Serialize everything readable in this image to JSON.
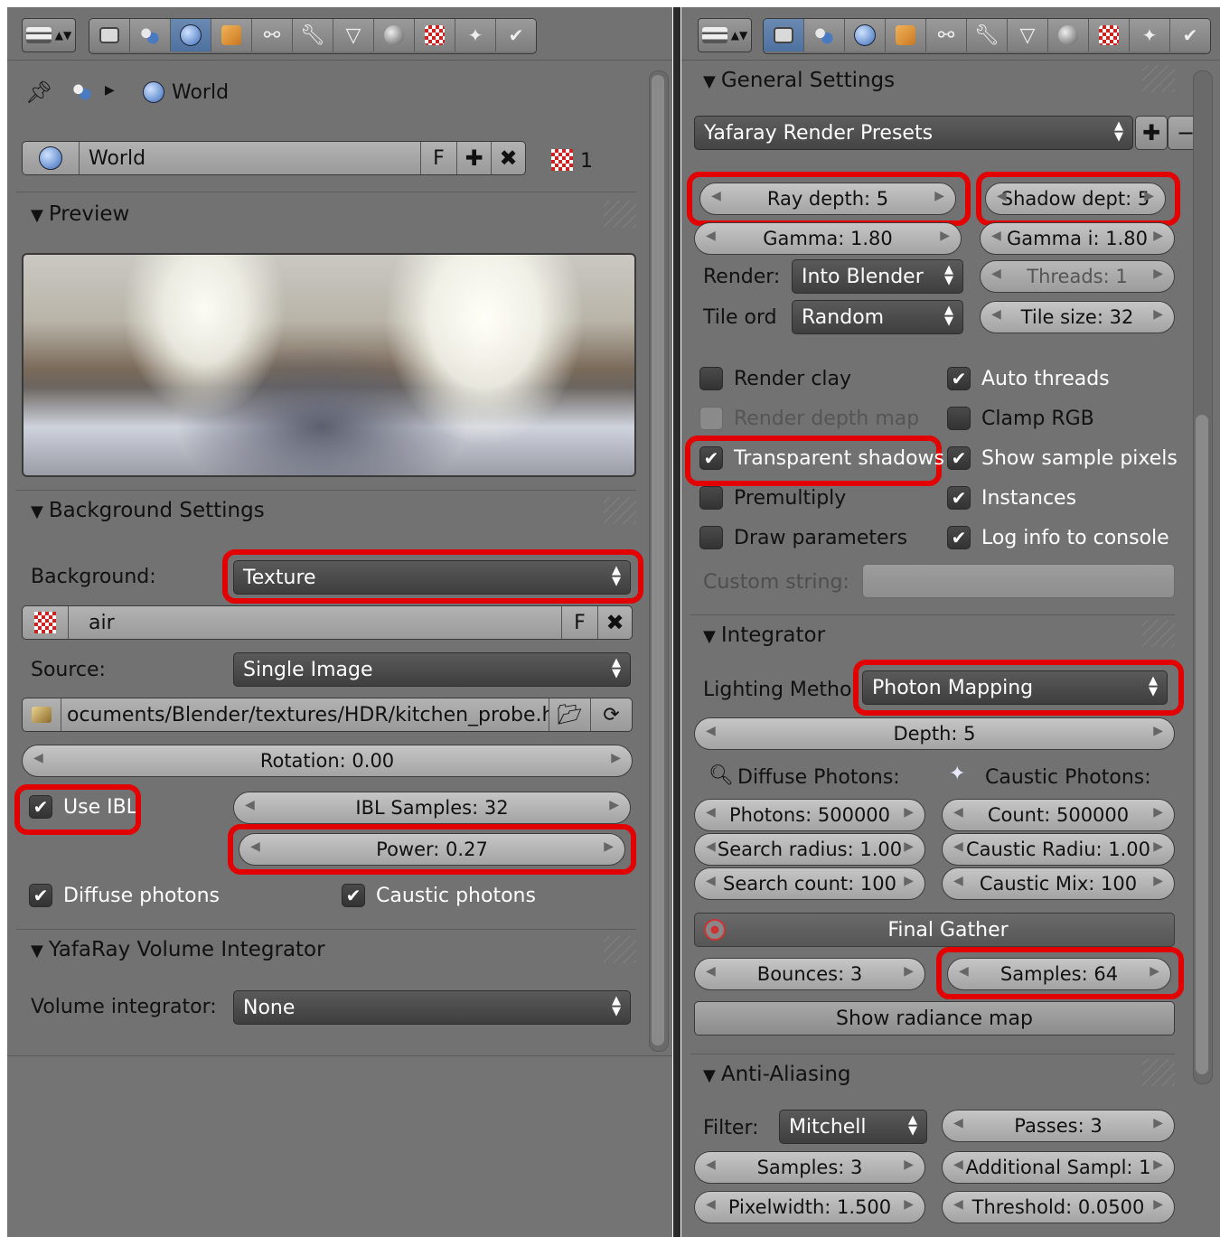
{
  "left": {
    "context": {
      "label": "World"
    },
    "datablock": {
      "name": "World",
      "fake_user": "F",
      "users": "1"
    },
    "preview": {
      "title": "Preview"
    },
    "background": {
      "title": "Background Settings",
      "background_label": "Background:",
      "background_value": "Texture",
      "texture_name": "air",
      "texture_fake_user": "F",
      "source_label": "Source:",
      "source_value": "Single Image",
      "filepath": "ocuments/Blender/textures/HDR/kitchen_probe.hdr",
      "rotation": "Rotation: 0.00",
      "use_ibl": "Use IBL",
      "ibl_samples": "IBL Samples: 32",
      "power": "Power: 0.27",
      "diffuse_photons": "Diffuse photons",
      "caustic_photons": "Caustic photons"
    },
    "volume": {
      "title": "YafaRay Volume Integrator",
      "label": "Volume integrator:",
      "value": "None"
    }
  },
  "right": {
    "general": {
      "title": "General Settings",
      "presets": "Yafaray Render Presets",
      "ray_depth": "Ray depth: 5",
      "shadow_depth": "Shadow dept: 5",
      "gamma": "Gamma: 1.80",
      "gamma_in": "Gamma i: 1.80",
      "render_label": "Render:",
      "render_value": "Into Blender",
      "threads": "Threads: 1",
      "tile_label": "Tile ord",
      "tile_value": "Random",
      "tile_size": "Tile size: 32",
      "checks_left": [
        {
          "label": "Render clay",
          "checked": false,
          "dim": false
        },
        {
          "label": "Render depth map",
          "checked": false,
          "dim": true
        },
        {
          "label": "Transparent shadows",
          "checked": true,
          "dim": false
        },
        {
          "label": "Premultiply",
          "checked": false,
          "dim": false
        },
        {
          "label": "Draw parameters",
          "checked": false,
          "dim": false
        }
      ],
      "checks_right": [
        {
          "label": "Auto threads",
          "checked": true
        },
        {
          "label": "Clamp RGB",
          "checked": false
        },
        {
          "label": "Show sample pixels",
          "checked": true
        },
        {
          "label": "Instances",
          "checked": true
        },
        {
          "label": "Log info to console",
          "checked": true
        }
      ],
      "custom_string_label": "Custom string:"
    },
    "integrator": {
      "title": "Integrator",
      "lighting_label": "Lighting Metho",
      "lighting_value": "Photon Mapping",
      "depth": "Depth: 5",
      "diffuse_title": "Diffuse Photons:",
      "caustic_title": "Caustic Photons:",
      "photons": "Photons: 500000",
      "search_radius": "Search radius: 1.00",
      "search_count": "Search count: 100",
      "count": "Count: 500000",
      "caustic_radius": "Caustic Radiu: 1.00",
      "caustic_mix": "Caustic Mix: 100",
      "final_gather": "Final Gather",
      "bounces": "Bounces: 3",
      "samples": "Samples: 64",
      "radiance_map": "Show radiance map"
    },
    "aa": {
      "title": "Anti-Aliasing",
      "filter_label": "Filter:",
      "filter_value": "Mitchell",
      "passes": "Passes: 3",
      "samples": "Samples: 3",
      "additional": "Additional Sampl: 1",
      "pixelwidth": "Pixelwidth: 1.500",
      "threshold": "Threshold: 0.0500"
    }
  },
  "colors": {
    "highlight": "#e30000",
    "panel": "#727272",
    "active_tab": "#5a7bab"
  }
}
